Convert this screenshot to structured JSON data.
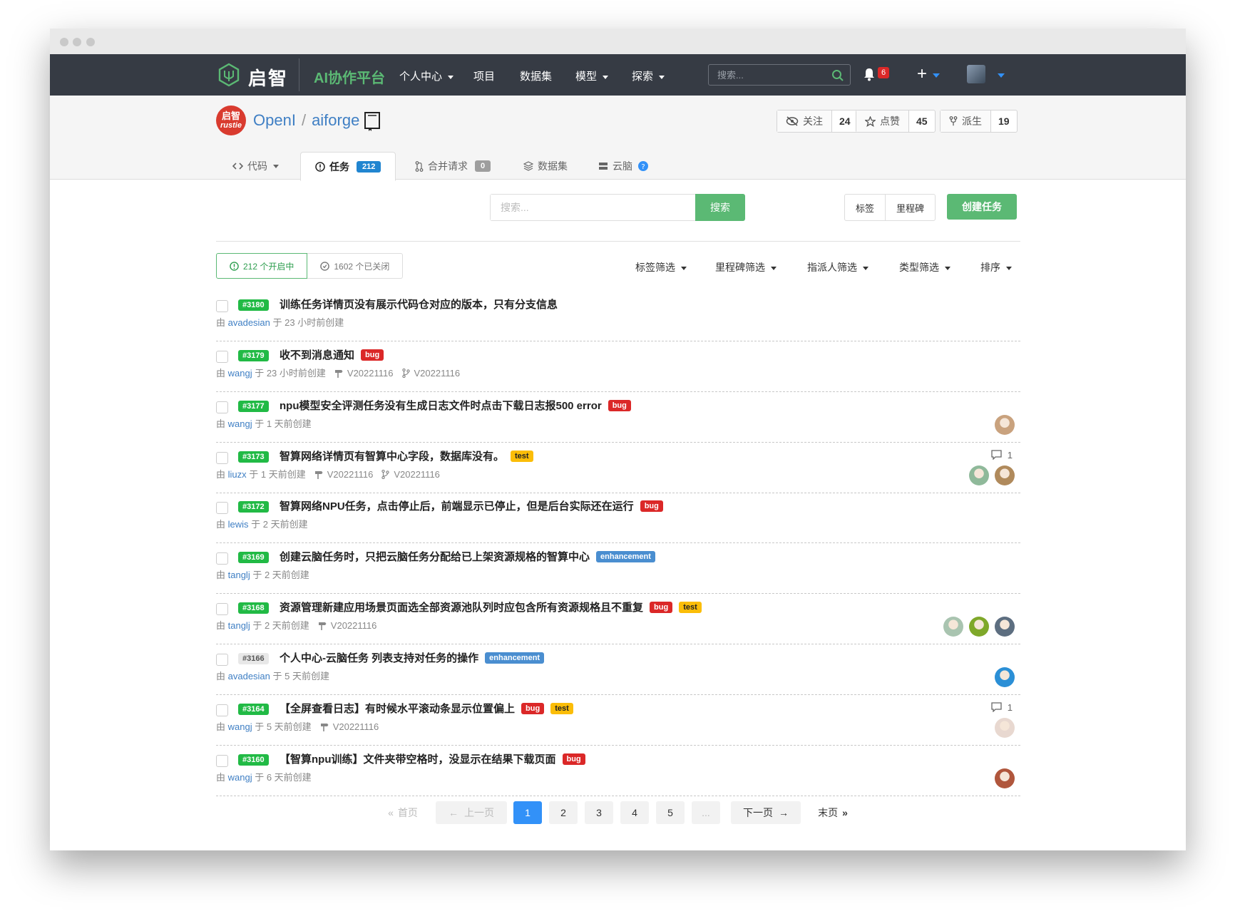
{
  "nav": {
    "logo_text": "启智",
    "platform": "AI协作平台",
    "items": [
      "个人中心",
      "项目",
      "数据集",
      "模型",
      "探索"
    ],
    "search_placeholder": "搜索...",
    "notification_count": "6"
  },
  "repo": {
    "owner": "OpenI",
    "name": "aiforge",
    "avatar_text_top": "启智",
    "avatar_text_bottom": "rustie",
    "watch_label": "关注",
    "watch_count": "24",
    "star_label": "点赞",
    "star_count": "45",
    "fork_label": "派生",
    "fork_count": "19"
  },
  "tabs": {
    "code": "代码",
    "issues": "任务",
    "issues_count": "212",
    "pulls": "合并请求",
    "pulls_count": "0",
    "datasets": "数据集",
    "cloudbrain": "云脑"
  },
  "toolbar": {
    "search_placeholder": "搜索...",
    "search_button": "搜索",
    "labels": "标签",
    "milestones": "里程碑",
    "create": "创建任务"
  },
  "state": {
    "open": "212 个开启中",
    "closed": "1602 个已关闭"
  },
  "filters": [
    "标签筛选",
    "里程碑筛选",
    "指派人筛选",
    "类型筛选",
    "排序"
  ],
  "issues": [
    {
      "num": "#3180",
      "title": "训练任务详情页没有展示代码仓对应的版本，只有分支信息",
      "user": "avadesian",
      "time": "于 23 小时前创建",
      "labels": [],
      "milestone": "",
      "branch": "",
      "comments": "",
      "avatars": []
    },
    {
      "num": "#3179",
      "title": "收不到消息通知",
      "user": "wangj",
      "time": "于 23 小时前创建",
      "labels": [
        "bug"
      ],
      "milestone": "V20221116",
      "branch": "V20221116",
      "comments": "",
      "avatars": []
    },
    {
      "num": "#3177",
      "title": "npu模型安全评测任务没有生成日志文件时点击下载日志报500 error",
      "user": "wangj",
      "time": "于 1 天前创建",
      "labels": [
        "bug"
      ],
      "milestone": "",
      "branch": "",
      "comments": "",
      "avatars": [
        "#c9a27e"
      ]
    },
    {
      "num": "#3173",
      "title": "智算网络详情页有智算中心字段，数据库没有。",
      "user": "liuzx",
      "time": "于 1 天前创建",
      "labels": [
        "test"
      ],
      "milestone": "V20221116",
      "branch": "V20221116",
      "comments": "1",
      "avatars": [
        "#8fb99a",
        "#b08a5c"
      ]
    },
    {
      "num": "#3172",
      "title": "智算网络NPU任务，点击停止后，前端显示已停止，但是后台实际还在运行",
      "user": "lewis",
      "time": "于 2 天前创建",
      "labels": [
        "bug"
      ],
      "milestone": "",
      "branch": "",
      "comments": "",
      "avatars": []
    },
    {
      "num": "#3169",
      "title": "创建云脑任务时，只把云脑任务分配给已上架资源规格的智算中心",
      "user": "tanglj",
      "time": "于 2 天前创建",
      "labels": [
        "enhancement"
      ],
      "milestone": "",
      "branch": "",
      "comments": "",
      "avatars": []
    },
    {
      "num": "#3168",
      "title": "资源管理新建应用场景页面选全部资源池队列时应包含所有资源规格且不重复",
      "user": "tanglj",
      "time": "于 2 天前创建",
      "labels": [
        "bug",
        "test"
      ],
      "milestone": "V20221116",
      "branch": "",
      "comments": "",
      "avatars": [
        "#a9c4b0",
        "#7fa82a",
        "#5d6e80"
      ]
    },
    {
      "num": "#3166",
      "title": "个人中心-云脑任务 列表支持对任务的操作",
      "user": "avadesian",
      "time": "于 5 天前创建",
      "labels": [
        "enhancement"
      ],
      "milestone": "",
      "branch": "",
      "comments": "",
      "avatars": [
        "#2b8fd6"
      ],
      "closed_style": true
    },
    {
      "num": "#3164",
      "title": "【全屏查看日志】有时候水平滚动条显示位置偏上",
      "user": "wangj",
      "time": "于 5 天前创建",
      "labels": [
        "bug",
        "test"
      ],
      "milestone": "V20221116",
      "branch": "",
      "comments": "1",
      "avatars": [
        "#e8d8d0"
      ]
    },
    {
      "num": "#3160",
      "title": "【智算npu训练】文件夹带空格时，没显示在结果下载页面",
      "user": "wangj",
      "time": "于 6 天前创建",
      "labels": [
        "bug"
      ],
      "milestone": "",
      "branch": "",
      "comments": "",
      "avatars": [
        "#b0563c"
      ]
    }
  ],
  "pagination": {
    "first": "首页",
    "prev": "上一页",
    "pages": [
      "1",
      "2",
      "3",
      "4",
      "5"
    ],
    "ellipsis": "...",
    "next": "下一页",
    "last": "末页",
    "current": "1"
  }
}
